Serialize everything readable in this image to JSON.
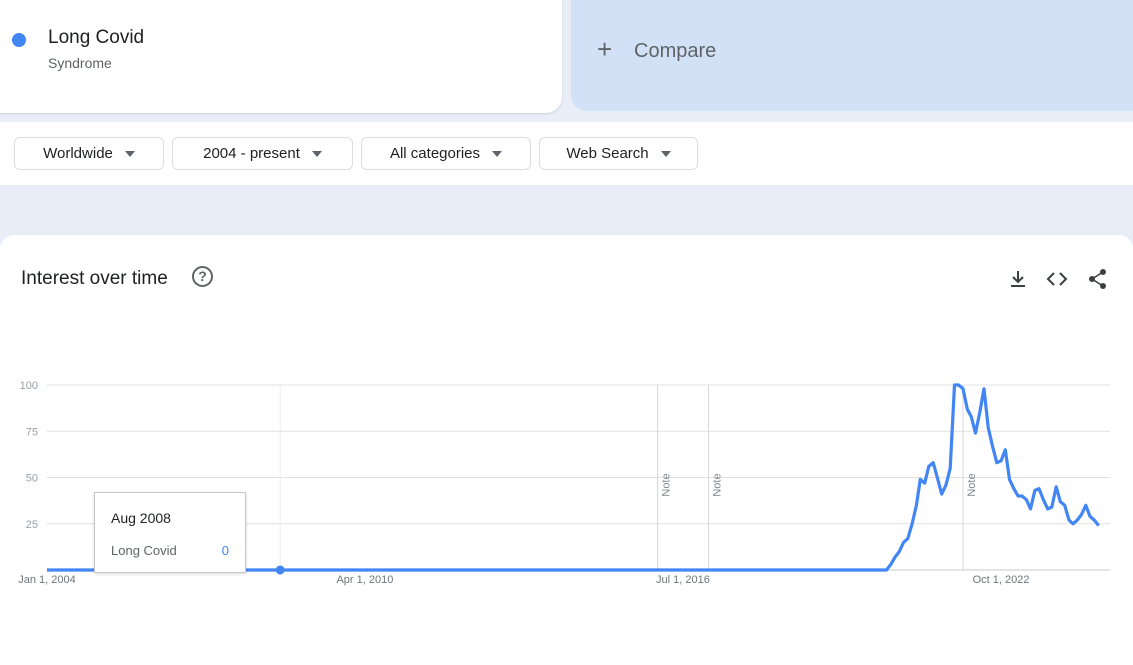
{
  "term": {
    "name": "Long Covid",
    "type": "Syndrome",
    "color": "#4285f4"
  },
  "compare": {
    "icon": "plus-icon",
    "label": "Compare"
  },
  "filters": [
    {
      "label": "Worldwide"
    },
    {
      "label": "2004 - present"
    },
    {
      "label": "All categories"
    },
    {
      "label": "Web Search"
    }
  ],
  "card": {
    "title": "Interest over time",
    "tools": [
      "download-icon",
      "embed-code-icon",
      "share-icon"
    ]
  },
  "tooltip": {
    "date": "Aug 2008",
    "term": "Long Covid",
    "value": "0"
  },
  "chart_data": {
    "type": "line",
    "ylim": [
      0,
      100
    ],
    "yticks": [
      "100",
      "75",
      "50",
      "25"
    ],
    "xtick_labels": [
      "Jan 1, 2004",
      "Apr 1, 2010",
      "Jul 1, 2016",
      "Oct 1, 2022"
    ],
    "xtick_dates": [
      "2004-01-01",
      "2010-04-01",
      "2016-07-01",
      "2022-10-01"
    ],
    "grid": true,
    "notes": [
      {
        "label": "Note",
        "date": "2016-01-01"
      },
      {
        "label": "Note",
        "date": "2017-01-01"
      },
      {
        "label": "Note",
        "date": "2022-01-01"
      }
    ],
    "highlight": {
      "date": "2008-08-01",
      "value": 0
    },
    "series": [
      {
        "name": "Long Covid",
        "color": "#4285f4",
        "points": [
          [
            "2004-01-01",
            0
          ],
          [
            "2020-07-01",
            0
          ],
          [
            "2020-08-01",
            3
          ],
          [
            "2020-09-01",
            7
          ],
          [
            "2020-10-01",
            10
          ],
          [
            "2020-11-01",
            15
          ],
          [
            "2020-12-01",
            17
          ],
          [
            "2021-01-01",
            25
          ],
          [
            "2021-02-01",
            35
          ],
          [
            "2021-03-01",
            49
          ],
          [
            "2021-04-01",
            47
          ],
          [
            "2021-05-01",
            56
          ],
          [
            "2021-06-01",
            58
          ],
          [
            "2021-07-01",
            50
          ],
          [
            "2021-08-01",
            41
          ],
          [
            "2021-09-01",
            46
          ],
          [
            "2021-10-01",
            55
          ],
          [
            "2021-11-01",
            100
          ],
          [
            "2021-12-01",
            100
          ],
          [
            "2022-01-01",
            98
          ],
          [
            "2022-02-01",
            87
          ],
          [
            "2022-03-01",
            83
          ],
          [
            "2022-04-01",
            74
          ],
          [
            "2022-05-01",
            85
          ],
          [
            "2022-06-01",
            98
          ],
          [
            "2022-07-01",
            77
          ],
          [
            "2022-08-01",
            67
          ],
          [
            "2022-09-01",
            58
          ],
          [
            "2022-10-01",
            59
          ],
          [
            "2022-11-01",
            65
          ],
          [
            "2022-12-01",
            49
          ],
          [
            "2023-01-01",
            44
          ],
          [
            "2023-02-01",
            40
          ],
          [
            "2023-03-01",
            40
          ],
          [
            "2023-04-01",
            38
          ],
          [
            "2023-05-01",
            33
          ],
          [
            "2023-06-01",
            43
          ],
          [
            "2023-07-01",
            44
          ],
          [
            "2023-08-01",
            38
          ],
          [
            "2023-09-01",
            33
          ],
          [
            "2023-10-01",
            34
          ],
          [
            "2023-11-01",
            45
          ],
          [
            "2023-12-01",
            37
          ],
          [
            "2024-01-01",
            35
          ],
          [
            "2024-02-01",
            27
          ],
          [
            "2024-03-01",
            25
          ],
          [
            "2024-04-01",
            27
          ],
          [
            "2024-05-01",
            30
          ],
          [
            "2024-06-01",
            35
          ],
          [
            "2024-07-01",
            29
          ],
          [
            "2024-08-01",
            27
          ],
          [
            "2024-09-01",
            24
          ]
        ]
      }
    ]
  }
}
